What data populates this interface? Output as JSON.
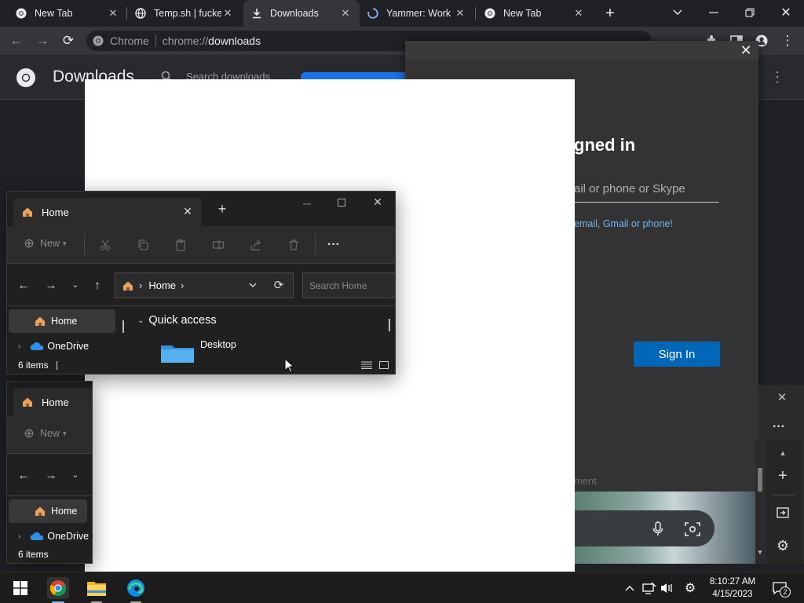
{
  "chrome": {
    "tabs": [
      {
        "title": "New Tab",
        "icon": "chrome-icon"
      },
      {
        "title": "Temp.sh | fucke",
        "icon": "globe-icon"
      },
      {
        "title": "Downloads",
        "icon": "download-icon",
        "active": true
      },
      {
        "title": "Yammer: Work",
        "icon": "loading-icon"
      },
      {
        "title": "New Tab",
        "icon": "chrome-icon"
      }
    ],
    "omnibox": {
      "prefix": "Chrome",
      "url_scheme": "chrome://",
      "url_host": "downloads"
    }
  },
  "downloads": {
    "title": "Downloads",
    "search_placeholder": "Search downloads"
  },
  "signin": {
    "title_fragment": "gned in",
    "field_placeholder_fragment": "ail or phone or Skype",
    "link_fragment": "email, Gmail or phone!",
    "button_label": "Sign In",
    "faint_text": "ment"
  },
  "explorer_front": {
    "tab_title": "Home",
    "new_label": "New",
    "address": "Home",
    "search_placeholder": "Search Home",
    "nav": [
      {
        "label": "Home"
      },
      {
        "label": "OneDrive"
      }
    ],
    "quick_access": "Quick access",
    "folder": "Desktop",
    "status": "6 items"
  },
  "explorer_back": {
    "tab_title": "Home",
    "new_label": "New",
    "nav": [
      {
        "label": "Home"
      },
      {
        "label": "OneDrive"
      }
    ],
    "status": "6 items"
  },
  "taskbar": {
    "time": "8:10:27 AM",
    "date": "4/15/2023",
    "notifications": "2"
  },
  "colors": {
    "accent": "#1a73e8",
    "signin_button": "#0067b8",
    "link": "#6cb8f6"
  }
}
